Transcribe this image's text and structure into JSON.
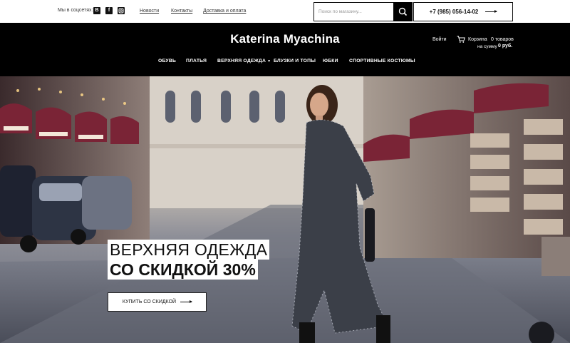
{
  "topbar": {
    "social_label": "Мы в соцсетях:",
    "social": [
      {
        "icon": "vk-icon",
        "glyph": "В"
      },
      {
        "icon": "facebook-icon",
        "glyph": "f"
      },
      {
        "icon": "instagram-icon",
        "glyph": "◙"
      }
    ],
    "links": [
      "Новости",
      "Контакты",
      "Доставка и оплата"
    ],
    "search_placeholder": "Поиск по магазину...",
    "phone": "+7 (985) 056-14-02"
  },
  "header": {
    "logo": "Katerina Myachina",
    "login": "Войти",
    "cart_label": "Корзина",
    "cart_count": "0 товаров",
    "cart_sum_label": "на сумму",
    "cart_sum": "0 руб."
  },
  "nav": {
    "items": [
      {
        "label": "ОБУВЬ"
      },
      {
        "label": "ПЛАТЬЯ"
      },
      {
        "label": "ВЕРХНЯЯ ОДЕЖДА",
        "has_dropdown": true
      },
      {
        "label": "БЛУЗКИ И ТОПЫ"
      },
      {
        "label": "ЮБКИ"
      },
      {
        "label": "СПОРТИВНЫЕ КОСТЮМЫ"
      }
    ],
    "dropdown_glyph": "▼"
  },
  "hero": {
    "headline_line1": "ВЕРХНЯЯ ОДЕЖДА",
    "headline_line2": "СО СКИДКОЙ 30%",
    "cta_label": "КУПИТЬ СО СКИДКОЙ"
  },
  "colors": {
    "header_bg": "#000000",
    "text": "#111111",
    "awning": "#7a2436",
    "coat": "#3b3f48"
  }
}
